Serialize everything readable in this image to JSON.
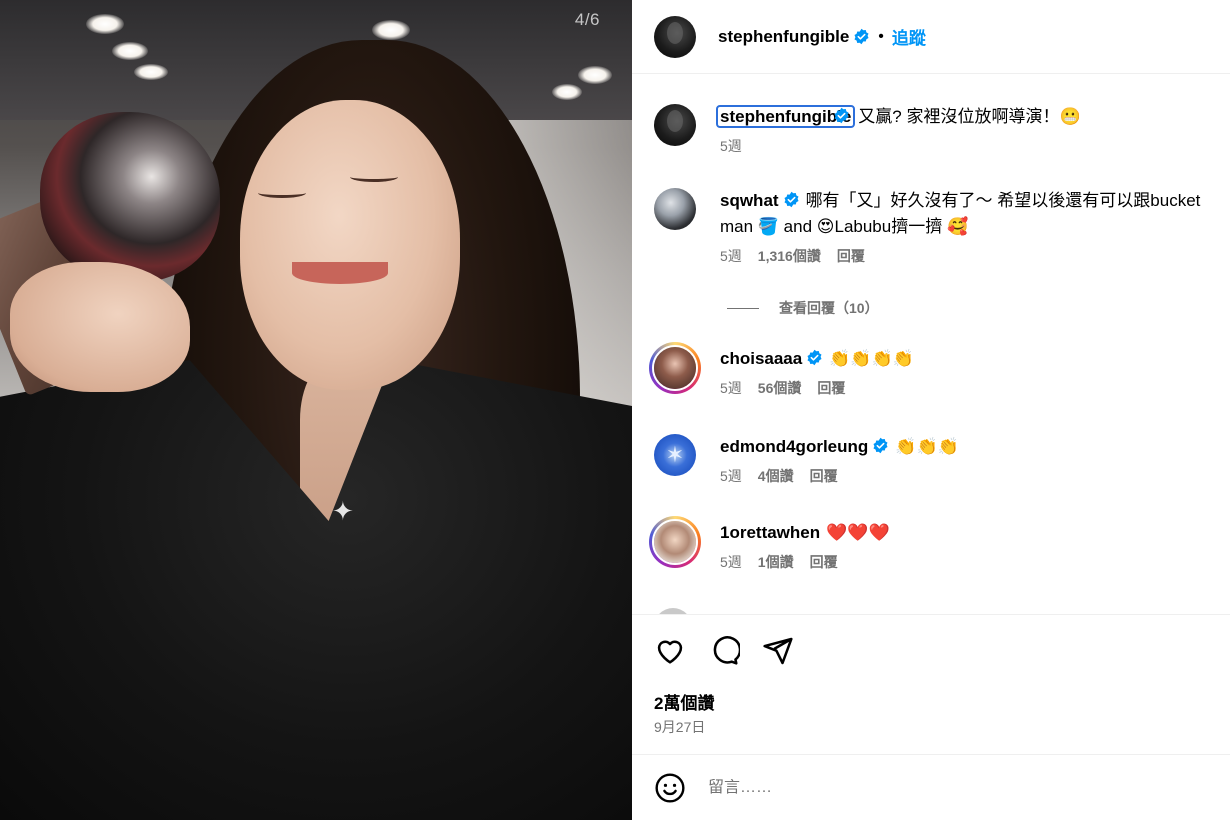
{
  "photo": {
    "counter": "4/6"
  },
  "header": {
    "username": "stephenfungible",
    "follow_label": "追蹤",
    "separator": "•"
  },
  "comments": [
    {
      "username": "stephenfungible",
      "verified": true,
      "text": "又贏? 家裡沒位放啊導演！😬",
      "age": "5週"
    },
    {
      "username": "sqwhat",
      "verified": true,
      "text": "哪有「又」好久沒有了～ 希望以後還有可以跟bucket man 🪣 and 😍Labubu擠一擠 🥰",
      "age": "5週",
      "likes": "1,316個讚",
      "reply": "回覆",
      "view_replies": "查看回覆（10）"
    },
    {
      "username": "choisaaaa",
      "verified": true,
      "text": "👏👏👏👏",
      "age": "5週",
      "likes": "56個讚",
      "reply": "回覆"
    },
    {
      "username": "edmond4gorleung",
      "verified": true,
      "text": "👏👏👏",
      "age": "5週",
      "likes": "4個讚",
      "reply": "回覆"
    },
    {
      "username": "1orettawhen",
      "verified": false,
      "text": "❤️❤️❤️",
      "age": "5週",
      "likes": "1個讚",
      "reply": "回覆"
    }
  ],
  "actions": {
    "icons": [
      "heart-icon",
      "comment-icon",
      "share-icon"
    ],
    "likes_total": "2萬個讚",
    "date": "9月27日"
  },
  "composer": {
    "placeholder": "留言……",
    "icon": "emoji-icon"
  },
  "colors": {
    "link_blue": "#0095f6",
    "meta_gray": "#737373",
    "verified_blue": "#0095f6",
    "focus_outline": "#2c6fdb"
  }
}
